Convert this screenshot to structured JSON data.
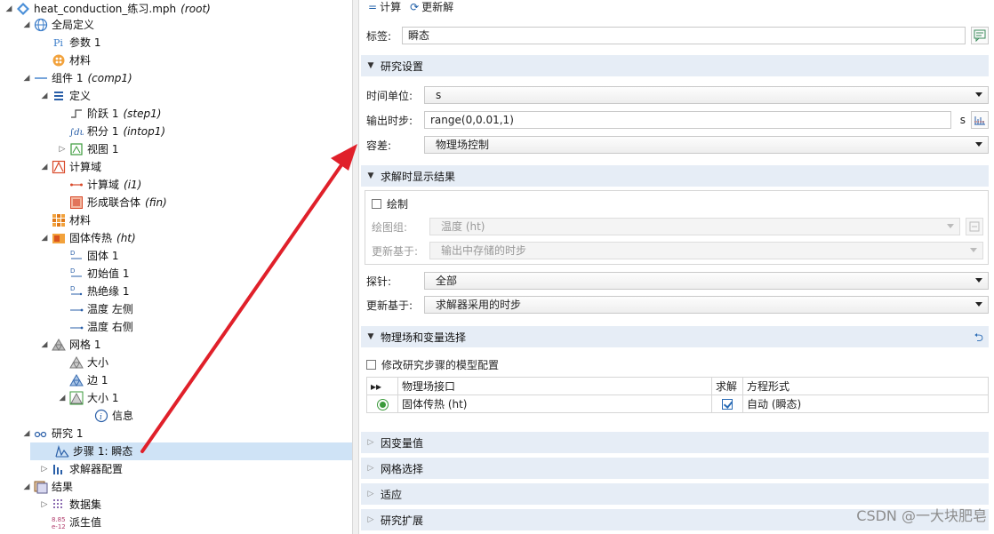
{
  "tree": {
    "root": {
      "label": "heat_conduction_练习.mph",
      "tag": "(root)"
    },
    "global_defs": {
      "label": "全局定义"
    },
    "params": {
      "label": "参数 1"
    },
    "materials_global": {
      "label": "材料"
    },
    "component": {
      "label": "组件 1",
      "tag": "(comp1)"
    },
    "definitions": {
      "label": "定义"
    },
    "step": {
      "label": "阶跃 1",
      "tag": "(step1)"
    },
    "integration": {
      "label": "积分 1",
      "tag": "(intop1)"
    },
    "view": {
      "label": "视图 1"
    },
    "geometry": {
      "label": "计算域"
    },
    "interval": {
      "label": "计算域",
      "tag": "(i1)"
    },
    "union": {
      "label": "形成联合体",
      "tag": "(fin)"
    },
    "materials": {
      "label": "材料"
    },
    "ht": {
      "label": "固体传热",
      "tag": "(ht)"
    },
    "solid": {
      "label": "固体 1"
    },
    "init": {
      "label": "初始值 1"
    },
    "insulation": {
      "label": "热绝缘 1"
    },
    "temp_left": {
      "label": "温度 左侧"
    },
    "temp_right": {
      "label": "温度 右侧"
    },
    "mesh": {
      "label": "网格 1"
    },
    "size": {
      "label": "大小"
    },
    "edge": {
      "label": "边 1"
    },
    "size1": {
      "label": "大小 1"
    },
    "info": {
      "label": "信息"
    },
    "study": {
      "label": "研究 1"
    },
    "step_transient": {
      "label": "步骤 1: 瞬态"
    },
    "solver": {
      "label": "求解器配置"
    },
    "results": {
      "label": "结果"
    },
    "datasets": {
      "label": "数据集"
    },
    "derived": {
      "label": "派生值"
    },
    "derived_icon_text": {
      "top": "8.85",
      "bottom": "e-12"
    }
  },
  "toolbar": {
    "compute": "计算",
    "update": "更新解"
  },
  "label_row": {
    "label": "标签:",
    "value": "瞬态"
  },
  "study_settings": {
    "title": "研究设置",
    "time_unit": {
      "label": "时间单位:",
      "value": "s"
    },
    "output_times": {
      "label": "输出时步:",
      "value": "range(0,0.01,1)",
      "unit": "s"
    },
    "tolerance": {
      "label": "容差:",
      "value": "物理场控制"
    }
  },
  "results_while_solving": {
    "title": "求解时显示结果",
    "plot": {
      "label": "绘制"
    },
    "plot_group": {
      "label": "绘图组:",
      "value": "温度 (ht)"
    },
    "update_at": {
      "label": "更新基于:",
      "value": "输出中存储的时步"
    },
    "probe": {
      "label": "探针:",
      "value": "全部"
    },
    "update_at2": {
      "label": "更新基于:",
      "value": "求解器采用的时步"
    }
  },
  "physics_selection": {
    "title": "物理场和变量选择",
    "modify": {
      "label": "修改研究步骤的模型配置"
    },
    "columns": [
      "物理场接口",
      "求解",
      "方程形式"
    ],
    "rows": [
      {
        "interface": "固体传热 (ht)",
        "form": "自动 (瞬态)"
      }
    ]
  },
  "collapsed_sections": [
    "因变量值",
    "网格选择",
    "适应",
    "研究扩展"
  ],
  "watermark": "CSDN @一大块肥皂",
  "colors": {
    "accent": "#1f5fa8",
    "section_bg": "#e6edf6",
    "selection": "#cfe3f6",
    "arrow": "#e0202a"
  }
}
